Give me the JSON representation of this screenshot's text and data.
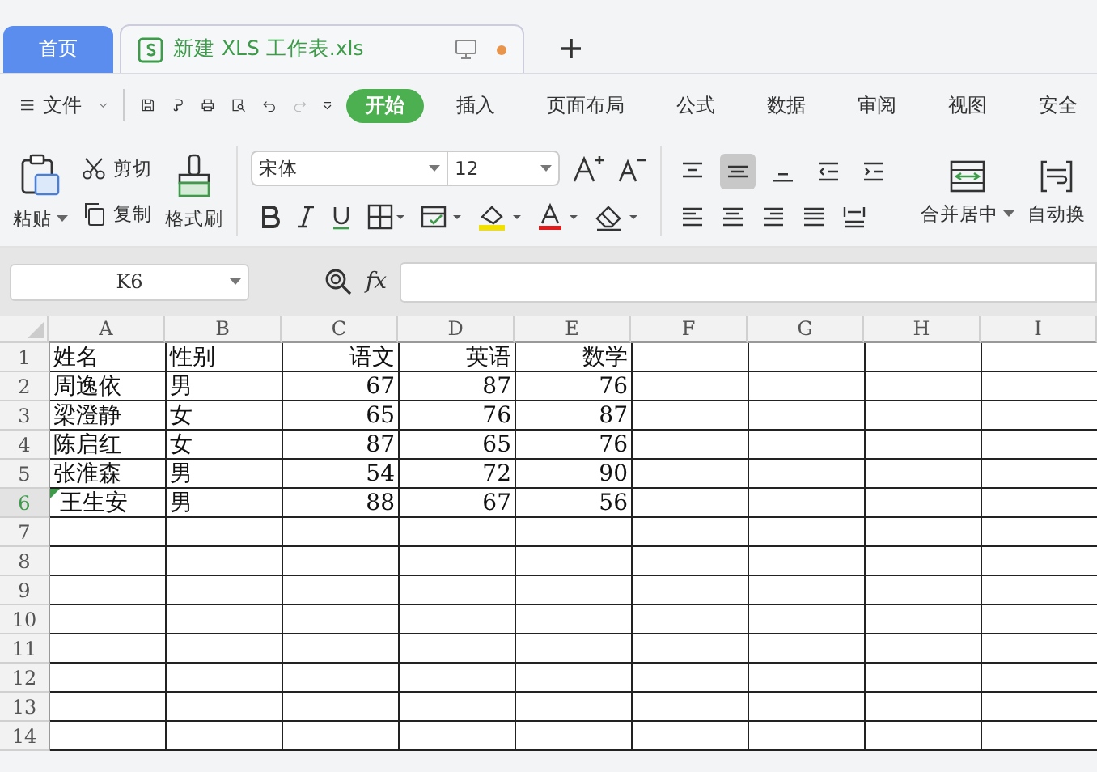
{
  "tabs": [
    {
      "label": "首页",
      "kind": "home",
      "selected": false
    },
    {
      "label": "新建 XLS 工作表.xls",
      "kind": "doc",
      "selected": true,
      "unsaved": true
    }
  ],
  "menu": {
    "file": "文件",
    "tabs": [
      {
        "label": "开始",
        "selected": true
      },
      {
        "label": "插入",
        "selected": false
      },
      {
        "label": "页面布局",
        "selected": false
      },
      {
        "label": "公式",
        "selected": false
      },
      {
        "label": "数据",
        "selected": false
      },
      {
        "label": "审阅",
        "selected": false
      },
      {
        "label": "视图",
        "selected": false
      },
      {
        "label": "安全",
        "selected": false
      }
    ]
  },
  "ribbon": {
    "paste": "粘贴",
    "cut": "剪切",
    "copy": "复制",
    "format_painter": "格式刷",
    "font": "宋体",
    "size": "12",
    "merge": "合并居中",
    "wrap": "自动换",
    "align_top": [
      {
        "kind": "top",
        "selected": false
      },
      {
        "kind": "middle",
        "selected": true
      },
      {
        "kind": "bottom",
        "selected": false
      },
      {
        "kind": "outdent",
        "selected": false
      },
      {
        "kind": "indent",
        "selected": false
      }
    ]
  },
  "formula_bar": {
    "cell_ref": "K6",
    "fx": "fx"
  },
  "sheet": {
    "columns": [
      {
        "label": "A",
        "kind": "text"
      },
      {
        "label": "B",
        "kind": "text"
      },
      {
        "label": "C",
        "kind": "number"
      },
      {
        "label": "D",
        "kind": "number"
      },
      {
        "label": "E",
        "kind": "number"
      },
      {
        "label": "F",
        "kind": "text"
      },
      {
        "label": "G",
        "kind": "text"
      },
      {
        "label": "H",
        "kind": "text"
      },
      {
        "label": "I",
        "kind": "text"
      }
    ],
    "rows": [
      {
        "header": "1",
        "selected": false,
        "cells": [
          "姓名",
          "性别",
          "语文",
          "英语",
          "数学"
        ]
      },
      {
        "header": "2",
        "selected": false,
        "cells": [
          "周逸依",
          "男",
          "67",
          "87",
          "76"
        ]
      },
      {
        "header": "3",
        "selected": false,
        "cells": [
          "梁澄静",
          "女",
          "65",
          "76",
          "87"
        ]
      },
      {
        "header": "4",
        "selected": false,
        "cells": [
          "陈启红",
          "女",
          "87",
          "65",
          "76"
        ]
      },
      {
        "header": "5",
        "selected": false,
        "cells": [
          "张淮森",
          "男",
          "54",
          "72",
          "90"
        ]
      },
      {
        "header": "6",
        "selected": true,
        "flagged": true,
        "cells": [
          "王生安",
          "男",
          "88",
          "67",
          "56"
        ]
      },
      {
        "header": "7",
        "selected": false
      },
      {
        "header": "8",
        "selected": false
      },
      {
        "header": "9",
        "selected": false
      },
      {
        "header": "10",
        "selected": false
      },
      {
        "header": "11",
        "selected": false
      },
      {
        "header": "12",
        "selected": false
      },
      {
        "header": "13",
        "selected": false
      },
      {
        "header": "14",
        "selected": false
      }
    ]
  }
}
